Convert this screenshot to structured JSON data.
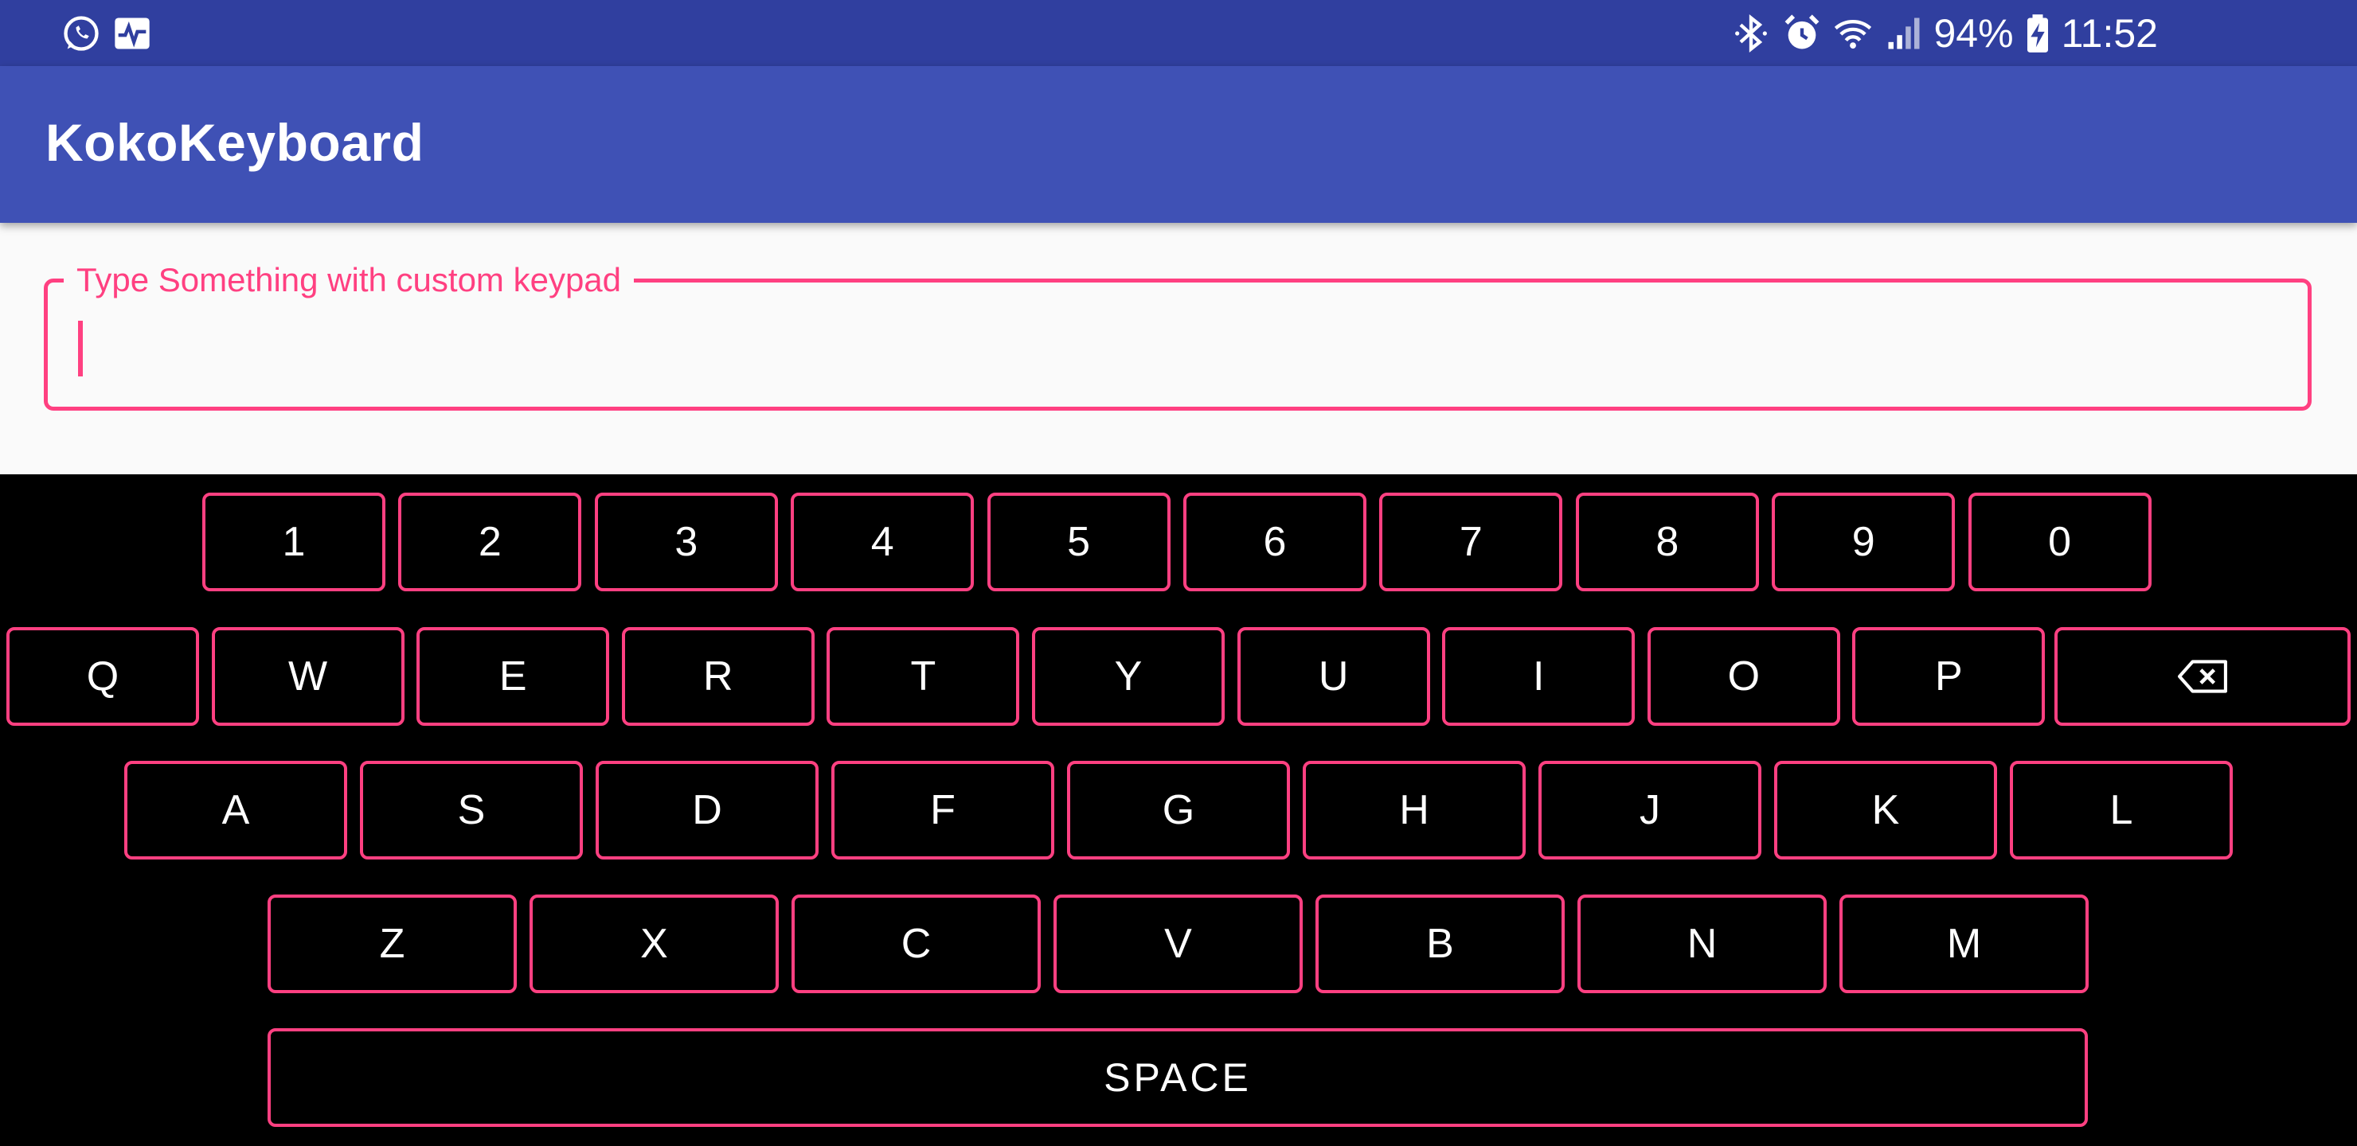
{
  "status_bar": {
    "icons_left": [
      "whatsapp-icon",
      "activity-monitor-icon"
    ],
    "icons_right": [
      "bluetooth-icon",
      "alarm-icon",
      "wifi-icon",
      "cell-signal-icon",
      "battery-charging-icon"
    ],
    "battery_percent": "94%",
    "time": "11:52"
  },
  "app_bar": {
    "title": "KokoKeyboard"
  },
  "input_field": {
    "label": "Type Something with custom keypad",
    "value": "",
    "accent_color": "#FF4081"
  },
  "keyboard": {
    "row_numbers": [
      "1",
      "2",
      "3",
      "4",
      "5",
      "6",
      "7",
      "8",
      "9",
      "0"
    ],
    "row_top": [
      "Q",
      "W",
      "E",
      "R",
      "T",
      "Y",
      "U",
      "I",
      "O",
      "P"
    ],
    "backspace_icon": "backspace-icon",
    "row_home": [
      "A",
      "S",
      "D",
      "F",
      "G",
      "H",
      "J",
      "K",
      "L"
    ],
    "row_bottom": [
      "Z",
      "X",
      "C",
      "V",
      "B",
      "N",
      "M"
    ],
    "space_label": "SPACE"
  },
  "colors": {
    "status_bar": "#303F9F",
    "app_bar": "#3F51B5",
    "accent": "#FF4081",
    "keyboard_bg": "#000000"
  }
}
